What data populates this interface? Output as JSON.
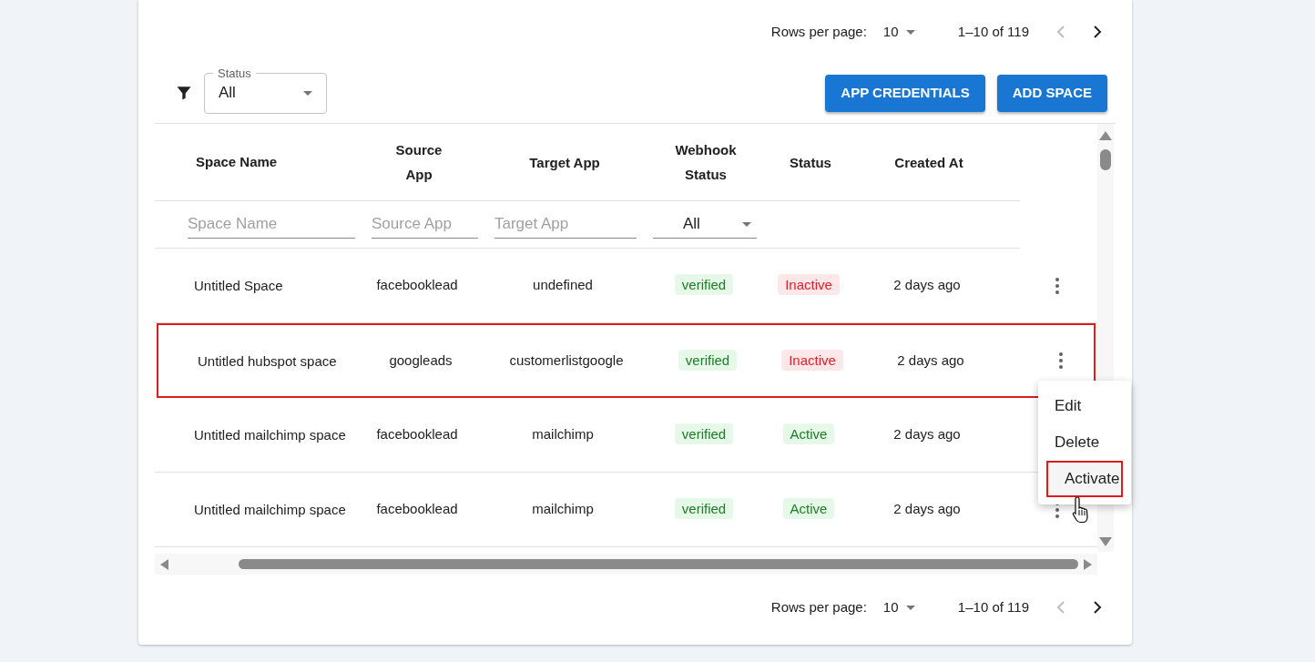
{
  "pagination_top": {
    "rows_per_page_label": "Rows per page:",
    "rows_per_page": "10",
    "range": "1–10 of 119"
  },
  "filter": {
    "label": "Status",
    "value": "All"
  },
  "buttons": [
    "APP CREDENTIALS",
    "ADD SPACE"
  ],
  "table": {
    "columns": [
      "Space Name",
      "Source App",
      "Target App",
      "Webhook Status",
      "Status",
      "Created At"
    ],
    "column_filters": [
      {
        "kind": "text",
        "placeholder": "Space Name"
      },
      {
        "kind": "text",
        "placeholder": "Source App"
      },
      {
        "kind": "text",
        "placeholder": "Target App"
      },
      {
        "kind": "select",
        "value": "All"
      }
    ],
    "rows": [
      {
        "space_name": "Untitled Space",
        "source_app": "facebooklead",
        "target_app": "undefined",
        "webhook_status": "verified",
        "status": {
          "label": "Inactive",
          "kind": "inactive"
        },
        "created_at": "2 days ago",
        "highlighted": false
      },
      {
        "space_name": "Untitled hubspot space",
        "source_app": "googleads",
        "target_app": "customerlistgoogle",
        "webhook_status": "verified",
        "status": {
          "label": "Inactive",
          "kind": "inactive"
        },
        "created_at": "2 days ago",
        "highlighted": true
      },
      {
        "space_name": "Untitled mailchimp space",
        "source_app": "facebooklead",
        "target_app": "mailchimp",
        "webhook_status": "verified",
        "status": {
          "label": "Active",
          "kind": "active"
        },
        "created_at": "2 days ago",
        "highlighted": false
      },
      {
        "space_name": "Untitled mailchimp space",
        "source_app": "facebooklead",
        "target_app": "mailchimp",
        "webhook_status": "verified",
        "status": {
          "label": "Active",
          "kind": "active"
        },
        "created_at": "2 days ago",
        "highlighted": false
      }
    ]
  },
  "row_menu": {
    "items": [
      {
        "label": "Edit",
        "highlighted": false
      },
      {
        "label": "Delete",
        "highlighted": false
      },
      {
        "label": "Activate",
        "highlighted": true
      }
    ]
  },
  "pagination_bottom": {
    "rows_per_page_label": "Rows per page:",
    "rows_per_page": "10",
    "range": "1–10 of 119"
  }
}
